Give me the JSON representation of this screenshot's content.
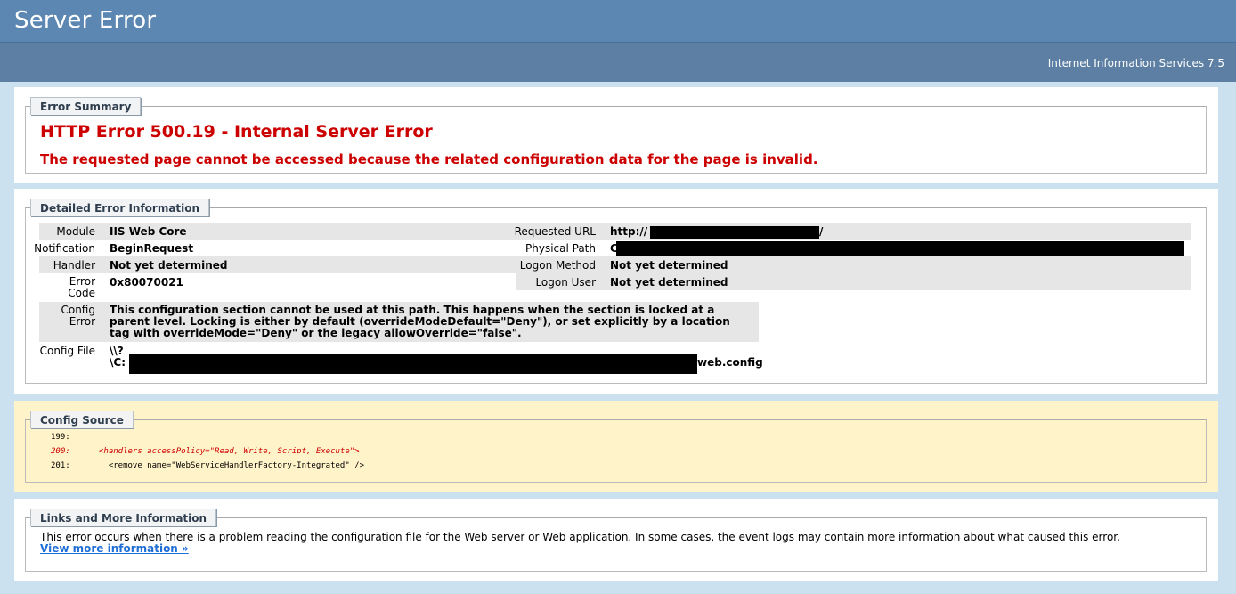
{
  "header": {
    "title": "Server Error",
    "subtitle": "Internet Information Services 7.5"
  },
  "summary": {
    "legend": "Error Summary",
    "title": "HTTP Error 500.19 - Internal Server Error",
    "description": "The requested page cannot be accessed because the related configuration data for the page is invalid."
  },
  "details": {
    "legend": "Detailed Error Information",
    "module_label": "Module",
    "module_value": "IIS Web Core",
    "notification_label": "Notification",
    "notification_value": "BeginRequest",
    "handler_label": "Handler",
    "handler_value": "Not yet determined",
    "error_code_label": "Error\nCode",
    "error_code_value": "0x80070021",
    "config_error_label": "Config\nError",
    "config_error_value": "This configuration section cannot be used at this path. This happens when the section is locked at a parent level. Locking is either by default (overrideModeDefault=\"Deny\"), or set explicitly by a location tag with overrideMode=\"Deny\" or the legacy allowOverride=\"false\".",
    "config_file_label": "Config File",
    "config_file_prefix": "\\\\?",
    "config_file_line2_start": "\\C:",
    "config_file_line2_end": "web.config",
    "requested_url_label": "Requested URL",
    "requested_url_prefix": "http://",
    "requested_url_suffix": "/",
    "physical_path_label": "Physical Path",
    "physical_path_prefix": "C:",
    "logon_method_label": "Logon Method",
    "logon_method_value": "Not yet determined",
    "logon_user_label": "Logon User",
    "logon_user_value": "Not yet determined"
  },
  "config_source": {
    "legend": "Config Source",
    "lines": [
      {
        "num": "199:",
        "text": ""
      },
      {
        "num": "200:",
        "text": "<handlers accessPolicy=\"Read, Write, Script, Execute\">"
      },
      {
        "num": "201:",
        "text": "  <remove name=\"WebServiceHandlerFactory-Integrated\" />"
      }
    ]
  },
  "links": {
    "legend": "Links and More Information",
    "text": "This error occurs when there is a problem reading the configuration file for the Web server or Web application. In some cases, the event logs may contain more information about what caused this error.",
    "more_link": "View more information »"
  },
  "colors": {
    "error_red": "#cc0000",
    "header_blue": "#5c87b2",
    "background": "#cbe1ef",
    "source_bg": "#fff3c9"
  }
}
